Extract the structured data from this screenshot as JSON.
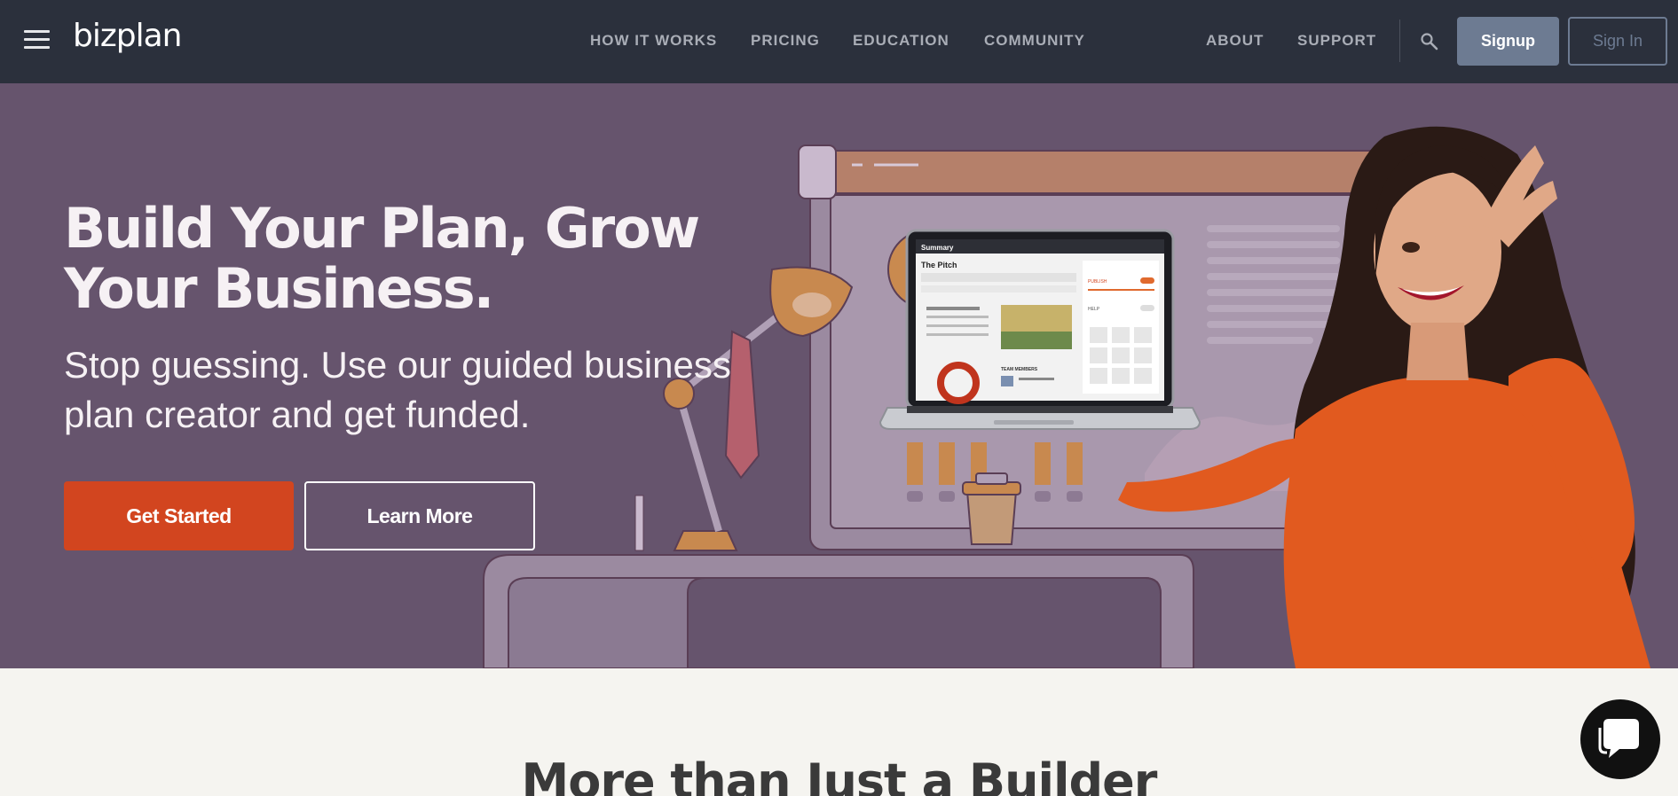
{
  "brand": {
    "logo_text": "bizplan"
  },
  "nav": {
    "menu_icon": "hamburger-menu-icon",
    "links": [
      {
        "label": "HOW IT WORKS"
      },
      {
        "label": "PRICING"
      },
      {
        "label": "EDUCATION"
      },
      {
        "label": "COMMUNITY"
      },
      {
        "label": "ABOUT"
      },
      {
        "label": "SUPPORT"
      }
    ],
    "search_icon": "search-icon",
    "signup_label": "Signup",
    "signin_label": "Sign In"
  },
  "hero": {
    "title": "Build Your Plan, Grow Your Business.",
    "subtitle": "Stop guessing. Use our guided business plan creator and get funded.",
    "primary_cta": "Get Started",
    "secondary_cta": "Learn More",
    "laptop_screen": {
      "header": "Summary",
      "section_title": "The Pitch",
      "publish_label": "PUBLISH",
      "help_label": "HELP",
      "team_label": "TEAM MEMBERS"
    }
  },
  "section": {
    "title": "More than Just a Builder"
  },
  "chat": {
    "icon": "chat-bubble-icon"
  },
  "colors": {
    "nav_bg": "#2b303c",
    "hero_bg": "#66546d",
    "accent": "#d2451f",
    "signup_bg": "#6d7b92",
    "page_bg": "#f5f4f0"
  }
}
